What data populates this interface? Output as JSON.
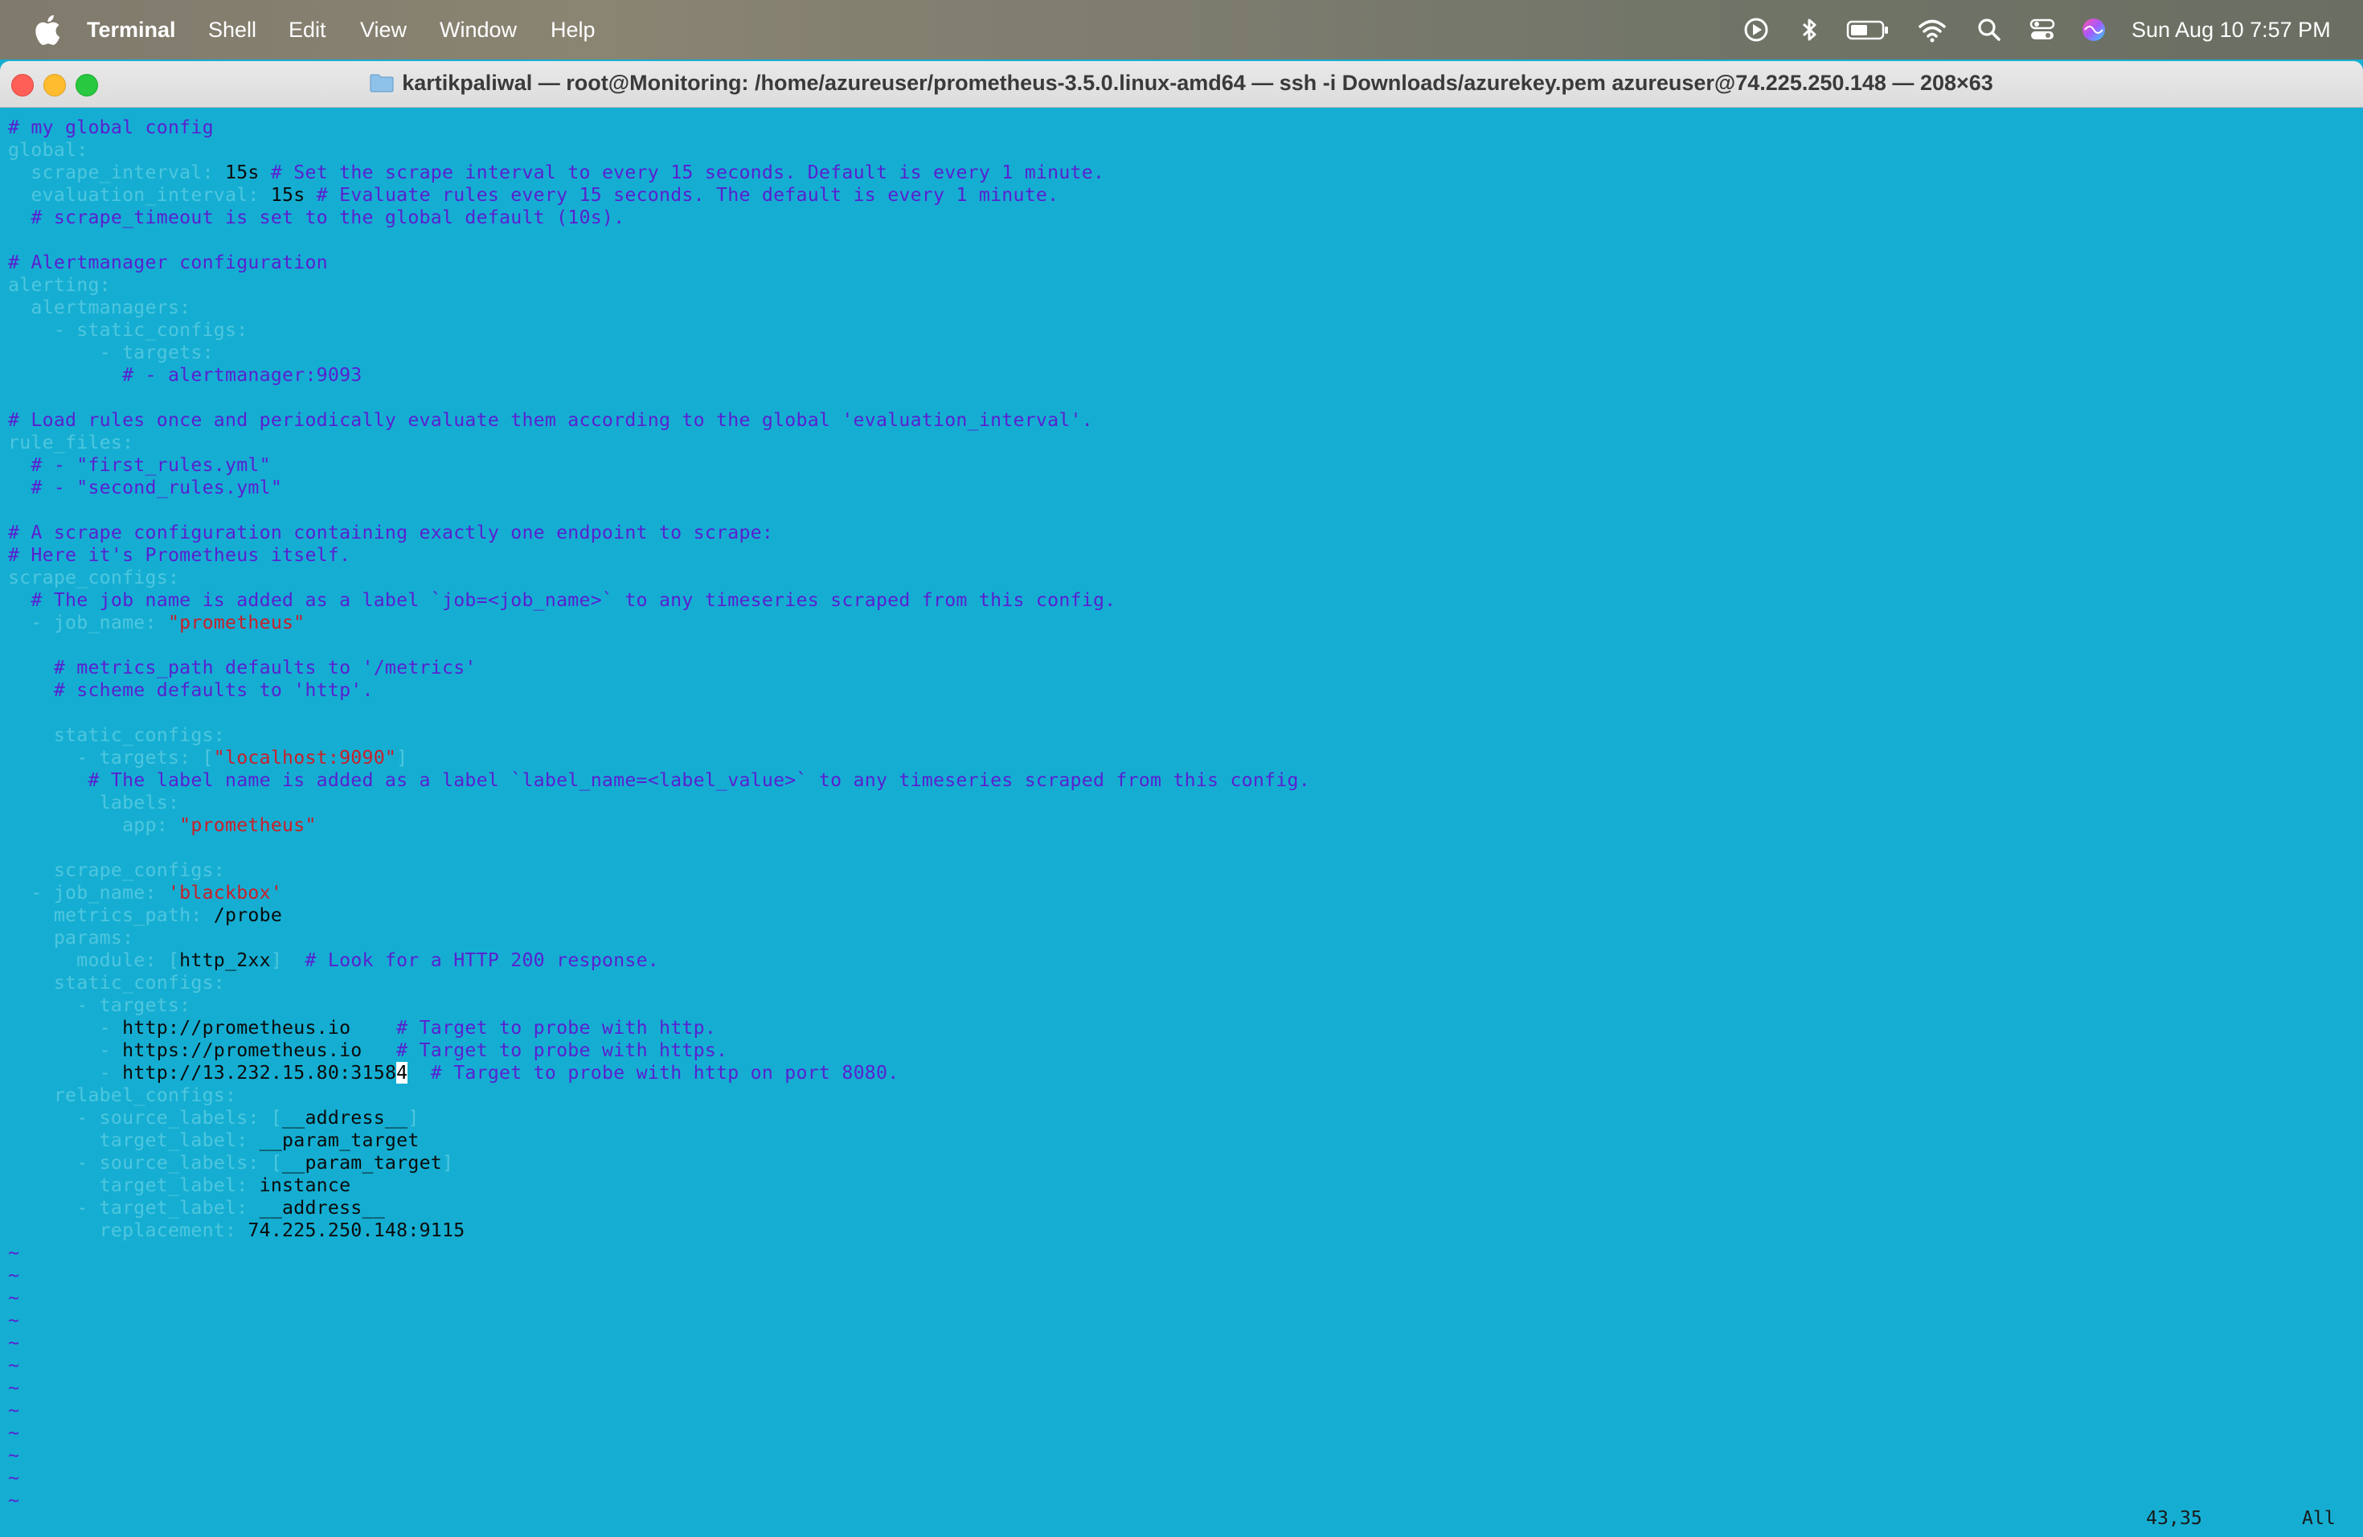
{
  "menubar": {
    "app_name": "Terminal",
    "items": [
      "Shell",
      "Edit",
      "View",
      "Window",
      "Help"
    ],
    "clock": "Sun Aug 10  7:57 PM"
  },
  "window": {
    "title": "kartikpaliwal — root@Monitoring: /home/azureuser/prometheus-3.5.0.linux-amd64 — ssh -i Downloads/azurekey.pem azureuser@74.225.250.148 — 208×63"
  },
  "colors": {
    "terminal_bg": "#15aed2",
    "comment": "#5a1fd0",
    "yaml_key": "#4fc6df",
    "string": "#c8202a",
    "value": "#0a0a0a"
  },
  "buffer": {
    "lines": [
      [
        {
          "t": "# my global config",
          "c": "comment"
        }
      ],
      [
        {
          "t": "global:",
          "c": "key"
        }
      ],
      [
        {
          "t": "  scrape_interval: ",
          "c": "key"
        },
        {
          "t": "15s",
          "c": "val"
        },
        {
          "t": " # Set the scrape interval to every 15 seconds. Default is every 1 minute.",
          "c": "comment"
        }
      ],
      [
        {
          "t": "  evaluation_interval: ",
          "c": "key"
        },
        {
          "t": "15s",
          "c": "val"
        },
        {
          "t": " # Evaluate rules every 15 seconds. The default is every 1 minute.",
          "c": "comment"
        }
      ],
      [
        {
          "t": "  # scrape_timeout is set to the global default (10s).",
          "c": "comment"
        }
      ],
      [],
      [
        {
          "t": "# Alertmanager configuration",
          "c": "comment"
        }
      ],
      [
        {
          "t": "alerting:",
          "c": "key"
        }
      ],
      [
        {
          "t": "  alertmanagers:",
          "c": "key"
        }
      ],
      [
        {
          "t": "    - static_configs:",
          "c": "key"
        }
      ],
      [
        {
          "t": "        - targets:",
          "c": "key"
        }
      ],
      [
        {
          "t": "          # - alertmanager:9093",
          "c": "comment"
        }
      ],
      [],
      [
        {
          "t": "# Load rules once and periodically evaluate them according to the global 'evaluation_interval'.",
          "c": "comment"
        }
      ],
      [
        {
          "t": "rule_files:",
          "c": "key"
        }
      ],
      [
        {
          "t": "  # - \"first_rules.yml\"",
          "c": "comment"
        }
      ],
      [
        {
          "t": "  # - \"second_rules.yml\"",
          "c": "comment"
        }
      ],
      [],
      [
        {
          "t": "# A scrape configuration containing exactly one endpoint to scrape:",
          "c": "comment"
        }
      ],
      [
        {
          "t": "# Here it's Prometheus itself.",
          "c": "comment"
        }
      ],
      [
        {
          "t": "scrape_configs:",
          "c": "key"
        }
      ],
      [
        {
          "t": "  # The job name is added as a label `job=<job_name>` to any timeseries scraped from this config.",
          "c": "comment"
        }
      ],
      [
        {
          "t": "  - job_name: ",
          "c": "key"
        },
        {
          "t": "\"prometheus\"",
          "c": "str"
        }
      ],
      [],
      [
        {
          "t": "    # metrics_path defaults to '/metrics'",
          "c": "comment"
        }
      ],
      [
        {
          "t": "    # scheme defaults to 'http'.",
          "c": "comment"
        }
      ],
      [],
      [
        {
          "t": "    static_configs:",
          "c": "key"
        }
      ],
      [
        {
          "t": "      - targets: [",
          "c": "key"
        },
        {
          "t": "\"localhost:9090\"",
          "c": "str"
        },
        {
          "t": "]",
          "c": "key"
        }
      ],
      [
        {
          "t": "       # The label name is added as a label `label_name=<label_value>` to any timeseries scraped from this config.",
          "c": "comment"
        }
      ],
      [
        {
          "t": "        labels:",
          "c": "key"
        }
      ],
      [
        {
          "t": "          app: ",
          "c": "key"
        },
        {
          "t": "\"prometheus\"",
          "c": "str"
        }
      ],
      [],
      [
        {
          "t": "    scrape_configs:",
          "c": "key"
        }
      ],
      [
        {
          "t": "  - job_name: ",
          "c": "key"
        },
        {
          "t": "'blackbox'",
          "c": "str"
        }
      ],
      [
        {
          "t": "    metrics_path: ",
          "c": "key"
        },
        {
          "t": "/probe",
          "c": "val"
        }
      ],
      [
        {
          "t": "    params:",
          "c": "key"
        }
      ],
      [
        {
          "t": "      module: [",
          "c": "key"
        },
        {
          "t": "http_2xx",
          "c": "val"
        },
        {
          "t": "]",
          "c": "key"
        },
        {
          "t": "  # Look for a HTTP 200 response.",
          "c": "comment"
        }
      ],
      [
        {
          "t": "    static_configs:",
          "c": "key"
        }
      ],
      [
        {
          "t": "      - targets:",
          "c": "key"
        }
      ],
      [
        {
          "t": "        - ",
          "c": "key"
        },
        {
          "t": "http://prometheus.io",
          "c": "val"
        },
        {
          "t": "    # Target to probe with http.",
          "c": "comment"
        }
      ],
      [
        {
          "t": "        - ",
          "c": "key"
        },
        {
          "t": "https://prometheus.io",
          "c": "val"
        },
        {
          "t": "   # Target to probe with https.",
          "c": "comment"
        }
      ],
      [
        {
          "t": "        - ",
          "c": "key"
        },
        {
          "t": "http://13.232.15.80:3158",
          "c": "val"
        },
        {
          "t": "4",
          "c": "cursor-ch"
        },
        {
          "t": "  # Target to probe with http on port 8080.",
          "c": "comment"
        }
      ],
      [
        {
          "t": "    relabel_configs:",
          "c": "key"
        }
      ],
      [
        {
          "t": "      - source_labels: [",
          "c": "key"
        },
        {
          "t": "__address__",
          "c": "val"
        },
        {
          "t": "]",
          "c": "key"
        }
      ],
      [
        {
          "t": "        target_label: ",
          "c": "key"
        },
        {
          "t": "__param_target",
          "c": "val"
        }
      ],
      [
        {
          "t": "      - source_labels: [",
          "c": "key"
        },
        {
          "t": "__param_target",
          "c": "val"
        },
        {
          "t": "]",
          "c": "key"
        }
      ],
      [
        {
          "t": "        target_label: ",
          "c": "key"
        },
        {
          "t": "instance",
          "c": "val"
        }
      ],
      [
        {
          "t": "      - target_label: ",
          "c": "key"
        },
        {
          "t": "__address__",
          "c": "val"
        }
      ],
      [
        {
          "t": "        replacement: ",
          "c": "key"
        },
        {
          "t": "74.225.250.148:9115",
          "c": "val"
        }
      ],
      [
        {
          "t": "~",
          "c": "tilde"
        }
      ],
      [
        {
          "t": "~",
          "c": "tilde"
        }
      ],
      [
        {
          "t": "~",
          "c": "tilde"
        }
      ],
      [
        {
          "t": "~",
          "c": "tilde"
        }
      ],
      [
        {
          "t": "~",
          "c": "tilde"
        }
      ],
      [
        {
          "t": "~",
          "c": "tilde"
        }
      ],
      [
        {
          "t": "~",
          "c": "tilde"
        }
      ],
      [
        {
          "t": "~",
          "c": "tilde"
        }
      ],
      [
        {
          "t": "~",
          "c": "tilde"
        }
      ],
      [
        {
          "t": "~",
          "c": "tilde"
        }
      ],
      [
        {
          "t": "~",
          "c": "tilde"
        }
      ],
      [
        {
          "t": "~",
          "c": "tilde"
        }
      ]
    ],
    "status_position": "43,35",
    "status_scroll": "All"
  }
}
